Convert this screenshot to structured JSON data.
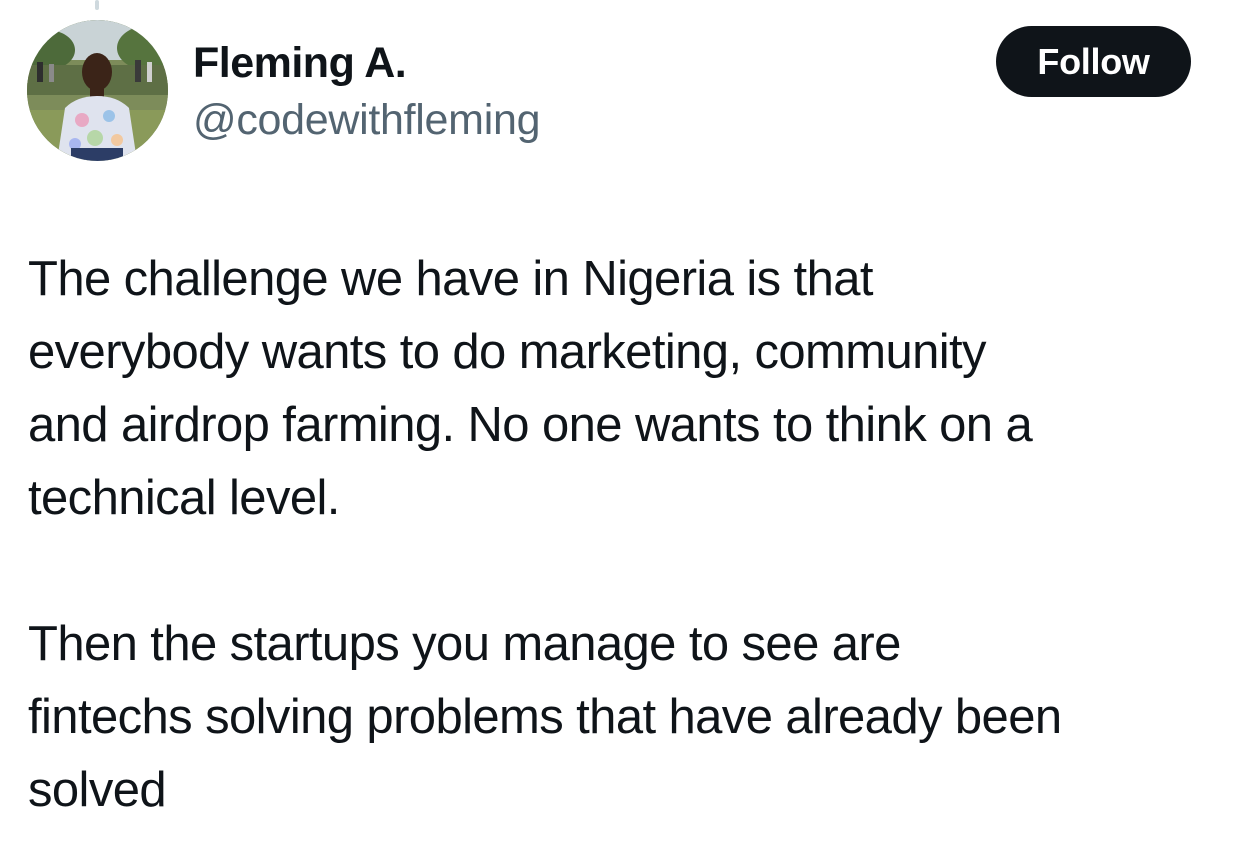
{
  "author": {
    "display_name": "Fleming A.",
    "handle": "@codewithfleming",
    "avatar_icon": "profile-photo"
  },
  "actions": {
    "follow_label": "Follow"
  },
  "tweet": {
    "paragraphs": [
      "The challenge we have in Nigeria is that\neverybody wants to do marketing, community\nand airdrop farming. No one wants to think on a\ntechnical level.",
      "Then the startups you manage to see are\nfintechs solving problems that have already been\nsolved"
    ]
  },
  "colors": {
    "text_primary": "#0f1419",
    "text_secondary": "#536471",
    "button_bg": "#0f1419",
    "button_text": "#ffffff",
    "thread_line": "#cfd9de"
  }
}
